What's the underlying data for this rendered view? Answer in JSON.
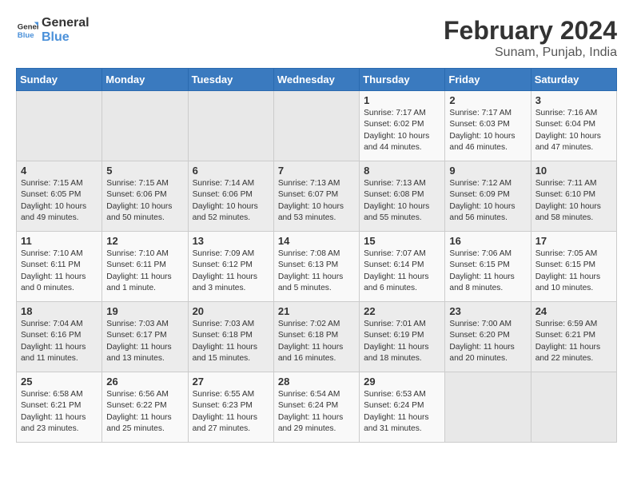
{
  "header": {
    "logo_line1": "General",
    "logo_line2": "Blue",
    "main_title": "February 2024",
    "subtitle": "Sunam, Punjab, India"
  },
  "days_of_week": [
    "Sunday",
    "Monday",
    "Tuesday",
    "Wednesday",
    "Thursday",
    "Friday",
    "Saturday"
  ],
  "weeks": [
    [
      {
        "num": "",
        "content": ""
      },
      {
        "num": "",
        "content": ""
      },
      {
        "num": "",
        "content": ""
      },
      {
        "num": "",
        "content": ""
      },
      {
        "num": "1",
        "content": "Sunrise: 7:17 AM\nSunset: 6:02 PM\nDaylight: 10 hours\nand 44 minutes."
      },
      {
        "num": "2",
        "content": "Sunrise: 7:17 AM\nSunset: 6:03 PM\nDaylight: 10 hours\nand 46 minutes."
      },
      {
        "num": "3",
        "content": "Sunrise: 7:16 AM\nSunset: 6:04 PM\nDaylight: 10 hours\nand 47 minutes."
      }
    ],
    [
      {
        "num": "4",
        "content": "Sunrise: 7:15 AM\nSunset: 6:05 PM\nDaylight: 10 hours\nand 49 minutes."
      },
      {
        "num": "5",
        "content": "Sunrise: 7:15 AM\nSunset: 6:06 PM\nDaylight: 10 hours\nand 50 minutes."
      },
      {
        "num": "6",
        "content": "Sunrise: 7:14 AM\nSunset: 6:06 PM\nDaylight: 10 hours\nand 52 minutes."
      },
      {
        "num": "7",
        "content": "Sunrise: 7:13 AM\nSunset: 6:07 PM\nDaylight: 10 hours\nand 53 minutes."
      },
      {
        "num": "8",
        "content": "Sunrise: 7:13 AM\nSunset: 6:08 PM\nDaylight: 10 hours\nand 55 minutes."
      },
      {
        "num": "9",
        "content": "Sunrise: 7:12 AM\nSunset: 6:09 PM\nDaylight: 10 hours\nand 56 minutes."
      },
      {
        "num": "10",
        "content": "Sunrise: 7:11 AM\nSunset: 6:10 PM\nDaylight: 10 hours\nand 58 minutes."
      }
    ],
    [
      {
        "num": "11",
        "content": "Sunrise: 7:10 AM\nSunset: 6:11 PM\nDaylight: 11 hours\nand 0 minutes."
      },
      {
        "num": "12",
        "content": "Sunrise: 7:10 AM\nSunset: 6:11 PM\nDaylight: 11 hours\nand 1 minute."
      },
      {
        "num": "13",
        "content": "Sunrise: 7:09 AM\nSunset: 6:12 PM\nDaylight: 11 hours\nand 3 minutes."
      },
      {
        "num": "14",
        "content": "Sunrise: 7:08 AM\nSunset: 6:13 PM\nDaylight: 11 hours\nand 5 minutes."
      },
      {
        "num": "15",
        "content": "Sunrise: 7:07 AM\nSunset: 6:14 PM\nDaylight: 11 hours\nand 6 minutes."
      },
      {
        "num": "16",
        "content": "Sunrise: 7:06 AM\nSunset: 6:15 PM\nDaylight: 11 hours\nand 8 minutes."
      },
      {
        "num": "17",
        "content": "Sunrise: 7:05 AM\nSunset: 6:15 PM\nDaylight: 11 hours\nand 10 minutes."
      }
    ],
    [
      {
        "num": "18",
        "content": "Sunrise: 7:04 AM\nSunset: 6:16 PM\nDaylight: 11 hours\nand 11 minutes."
      },
      {
        "num": "19",
        "content": "Sunrise: 7:03 AM\nSunset: 6:17 PM\nDaylight: 11 hours\nand 13 minutes."
      },
      {
        "num": "20",
        "content": "Sunrise: 7:03 AM\nSunset: 6:18 PM\nDaylight: 11 hours\nand 15 minutes."
      },
      {
        "num": "21",
        "content": "Sunrise: 7:02 AM\nSunset: 6:18 PM\nDaylight: 11 hours\nand 16 minutes."
      },
      {
        "num": "22",
        "content": "Sunrise: 7:01 AM\nSunset: 6:19 PM\nDaylight: 11 hours\nand 18 minutes."
      },
      {
        "num": "23",
        "content": "Sunrise: 7:00 AM\nSunset: 6:20 PM\nDaylight: 11 hours\nand 20 minutes."
      },
      {
        "num": "24",
        "content": "Sunrise: 6:59 AM\nSunset: 6:21 PM\nDaylight: 11 hours\nand 22 minutes."
      }
    ],
    [
      {
        "num": "25",
        "content": "Sunrise: 6:58 AM\nSunset: 6:21 PM\nDaylight: 11 hours\nand 23 minutes."
      },
      {
        "num": "26",
        "content": "Sunrise: 6:56 AM\nSunset: 6:22 PM\nDaylight: 11 hours\nand 25 minutes."
      },
      {
        "num": "27",
        "content": "Sunrise: 6:55 AM\nSunset: 6:23 PM\nDaylight: 11 hours\nand 27 minutes."
      },
      {
        "num": "28",
        "content": "Sunrise: 6:54 AM\nSunset: 6:24 PM\nDaylight: 11 hours\nand 29 minutes."
      },
      {
        "num": "29",
        "content": "Sunrise: 6:53 AM\nSunset: 6:24 PM\nDaylight: 11 hours\nand 31 minutes."
      },
      {
        "num": "",
        "content": ""
      },
      {
        "num": "",
        "content": ""
      }
    ]
  ]
}
